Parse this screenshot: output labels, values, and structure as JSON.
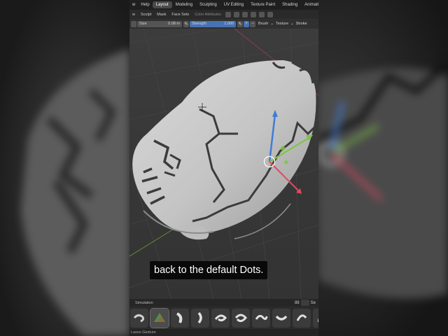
{
  "menu": {
    "view": "w",
    "help": "Help"
  },
  "workspace_tabs": {
    "layout": "Layout",
    "modeling": "Modeling",
    "sculpting": "Sculpting",
    "uv_editing": "UV Editing",
    "texture_paint": "Texture Paint",
    "shading": "Shading",
    "animation": "Animati"
  },
  "header": {
    "view": "w",
    "sculpt": "Sculpt",
    "mask": "Mask",
    "face_sets": "Face Sets",
    "color_attributes": "Color Attributes"
  },
  "tool_settings": {
    "size_label": "Size",
    "size_value": "0.08 m",
    "strength_label": "Strength",
    "strength_value": "1.000",
    "plus": "+",
    "minus": "−",
    "brush": "Brush",
    "texture": "Texture",
    "stroke": "Stroke"
  },
  "subtitle": {
    "text": "back to the default Dots."
  },
  "shelf": {
    "label": "Simulation",
    "search_glyph": "88",
    "right_glyph": "Se"
  },
  "status": {
    "tool_name": "Lasso Gesture"
  },
  "colors": {
    "accent_blue": "#4772b3",
    "gizmo_x": "#e04a62",
    "gizmo_y": "#7ec542",
    "gizmo_z": "#3e7cd8",
    "mesh_grey": "#c8c8c8"
  }
}
